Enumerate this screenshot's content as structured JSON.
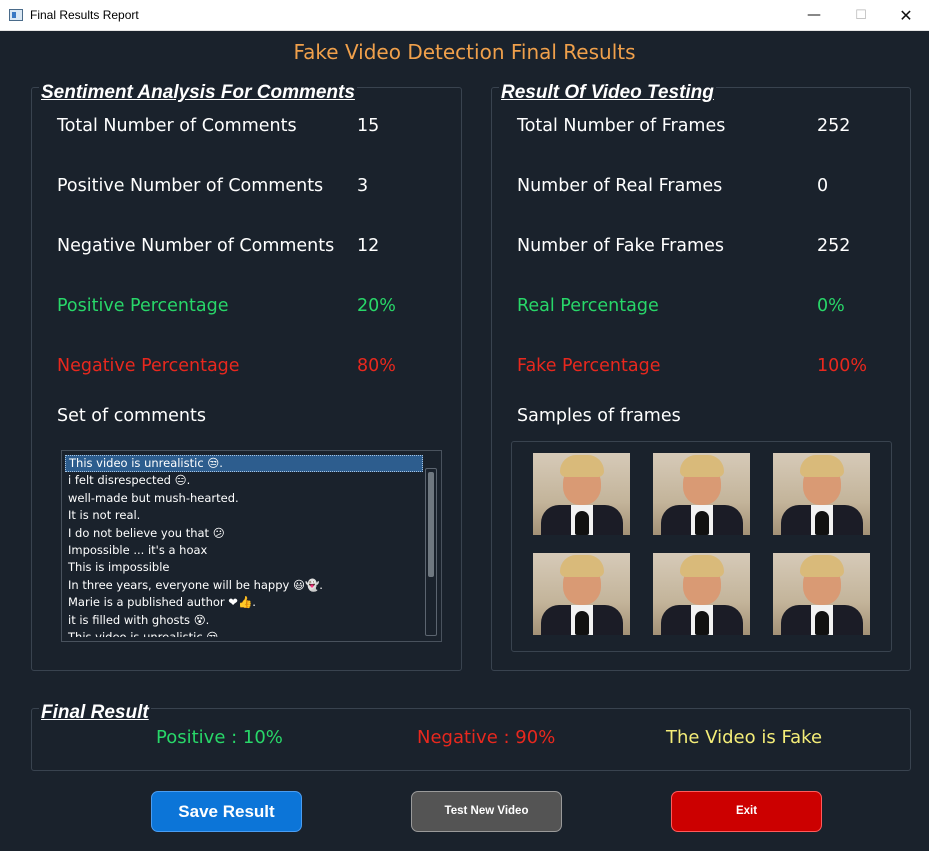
{
  "window": {
    "title": "Final Results Report",
    "minimize_glyph": "—",
    "maximize_glyph": "☐",
    "close_glyph": "✕"
  },
  "main_title": "Fake Video Detection Final Results",
  "sentiment": {
    "legend": "Sentiment Analysis For Comments",
    "total_label": "Total Number of Comments",
    "total_value": "15",
    "positive_label": "Positive Number of Comments",
    "positive_value": "3",
    "negative_label": "Negative Number of Comments",
    "negative_value": "12",
    "positive_pct_label": "Positive Percentage",
    "positive_pct_value": "20%",
    "negative_pct_label": "Negative Percentage",
    "negative_pct_value": "80%",
    "comments_label": "Set of comments",
    "comments": [
      "This video is unrealistic 😒.",
      "i felt disrespected 😑.",
      "well-made but mush-hearted.",
      "It is not real.",
      "I do not believe you that 😕",
      "Impossible ... it's a hoax",
      "This is impossible",
      "In three years, everyone will be happy 😃👻.",
      "Marie is a published author ❤👍.",
      "it is filled with ghosts 😵.",
      "This video is unrealistic 😒."
    ]
  },
  "video": {
    "legend": "Result Of Video Testing",
    "total_label": "Total Number of Frames",
    "total_value": "252",
    "real_label": "Number of Real Frames",
    "real_value": "0",
    "fake_label": "Number of Fake Frames",
    "fake_value": "252",
    "real_pct_label": "Real Percentage",
    "real_pct_value": "0%",
    "fake_pct_label": "Fake Percentage",
    "fake_pct_value": "100%",
    "samples_label": "Samples of frames"
  },
  "final": {
    "legend": "Final Result",
    "positive": "Positive : 10%",
    "negative": "Negative : 90%",
    "verdict": "The Video is Fake"
  },
  "buttons": {
    "save": "Save Result",
    "test": "Test New Video",
    "exit": "Exit"
  },
  "colors": {
    "background": "#1a222c",
    "title_orange": "#f0a04b",
    "positive_green": "#28d769",
    "negative_red": "#e8281e",
    "verdict_yellow": "#f4ed78",
    "save_blue": "#0c75d8",
    "test_gray": "#545454",
    "exit_red": "#cc0000"
  }
}
